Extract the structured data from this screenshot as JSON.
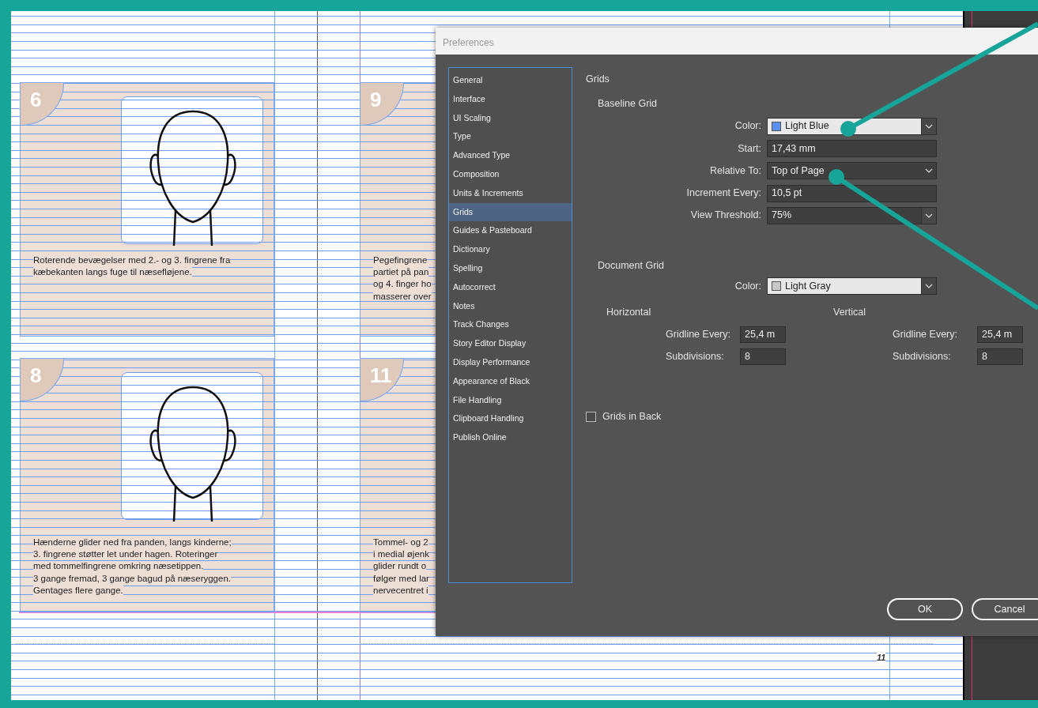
{
  "document": {
    "cards": [
      {
        "number": "6",
        "lines": [
          "Roterende bevægelser med 2.- og 3. fingrene fra",
          "kæbekanten langs fuge til næsefløjene."
        ]
      },
      {
        "number": "9",
        "lines": [
          "Pegefingrene",
          "partiet på pan",
          "og 4. finger ho",
          "masserer over"
        ]
      },
      {
        "number": "8",
        "lines": [
          "Hænderne glider ned fra panden, langs kinderne;",
          "3. fingrene støtter let under hagen. Roteringer",
          "med tommelfingrene omkring næsetippen.",
          "3 gange fremad, 3 gange bagud på næseryggen.",
          "Gentages flere gange."
        ]
      },
      {
        "number": "11",
        "lines": [
          "Tommel- og 2",
          "i medial øjenk",
          "glider rundt o",
          "følger med lar",
          "nervecentret i"
        ]
      }
    ],
    "folio": "11"
  },
  "dialog": {
    "title": "Preferences",
    "categories": [
      {
        "label": "General",
        "selected": false
      },
      {
        "label": "Interface",
        "selected": false
      },
      {
        "label": "UI Scaling",
        "selected": false
      },
      {
        "label": "Type",
        "selected": false
      },
      {
        "label": "Advanced Type",
        "selected": false
      },
      {
        "label": "Composition",
        "selected": false
      },
      {
        "label": "Units & Increments",
        "selected": false
      },
      {
        "label": "Grids",
        "selected": true
      },
      {
        "label": "Guides & Pasteboard",
        "selected": false
      },
      {
        "label": "Dictionary",
        "selected": false
      },
      {
        "label": "Spelling",
        "selected": false
      },
      {
        "label": "Autocorrect",
        "selected": false
      },
      {
        "label": "Notes",
        "selected": false
      },
      {
        "label": "Track Changes",
        "selected": false
      },
      {
        "label": "Story Editor Display",
        "selected": false
      },
      {
        "label": "Display Performance",
        "selected": false
      },
      {
        "label": "Appearance of Black",
        "selected": false
      },
      {
        "label": "File Handling",
        "selected": false
      },
      {
        "label": "Clipboard Handling",
        "selected": false
      },
      {
        "label": "Publish Online",
        "selected": false
      }
    ],
    "section_title": "Grids",
    "baseline_grid": {
      "heading": "Baseline Grid",
      "fields": [
        {
          "kind": "color",
          "label": "Color:",
          "value": "Light Blue",
          "color": "#5b8ff0"
        },
        {
          "kind": "text",
          "label": "Start:",
          "value": "17,43 mm"
        },
        {
          "kind": "select",
          "label": "Relative To:",
          "value": "Top of Page"
        },
        {
          "kind": "text",
          "label": "Increment Every:",
          "value": "10,5 pt"
        },
        {
          "kind": "combo",
          "label": "View Threshold:",
          "value": "75%"
        }
      ]
    },
    "document_grid": {
      "heading": "Document Grid",
      "color_field": {
        "kind": "color",
        "label": "Color:",
        "value": "Light Gray",
        "color": "#c8c8c8"
      },
      "horizontal": {
        "heading": "Horizontal",
        "fields": [
          {
            "label": "Gridline Every:",
            "value": "25,4 m"
          },
          {
            "label": "Subdivisions:",
            "value": "8"
          }
        ]
      },
      "vertical": {
        "heading": "Vertical",
        "fields": [
          {
            "label": "Gridline Every:",
            "value": "25,4 m"
          },
          {
            "label": "Subdivisions:",
            "value": "8"
          }
        ]
      }
    },
    "grids_in_back": {
      "label": "Grids in Back",
      "checked": false
    },
    "buttons": [
      {
        "label": "OK",
        "kind": "default"
      },
      {
        "label": "Cancel",
        "kind": "normal"
      }
    ]
  }
}
